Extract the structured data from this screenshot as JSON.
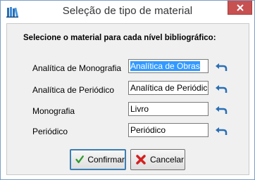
{
  "window": {
    "title": "Seleção de tipo de material",
    "close_label": "✕"
  },
  "instruction": "Selecione o material para cada nível bibliográfico:",
  "fields": [
    {
      "label": "Analítica de Monografia",
      "value": "Analítica de Obras"
    },
    {
      "label": "Analítica de Periódico",
      "value": "Analítica de Periódico"
    },
    {
      "label": "Monografia",
      "value": "Livro"
    },
    {
      "label": "Periódico",
      "value": "Periódico"
    }
  ],
  "buttons": {
    "confirm_label": "Confirmar",
    "cancel_label": "Cancelar"
  },
  "colors": {
    "accent": "#3399ff",
    "close": "#c75050",
    "confirm_icon": "#2e9b2e",
    "cancel_icon": "#d42020",
    "undo_icon": "#2a6fb5"
  },
  "icons": {
    "app": "books-icon",
    "field_action": "undo-arrow-icon",
    "confirm": "checkmark-icon",
    "cancel": "x-icon"
  }
}
